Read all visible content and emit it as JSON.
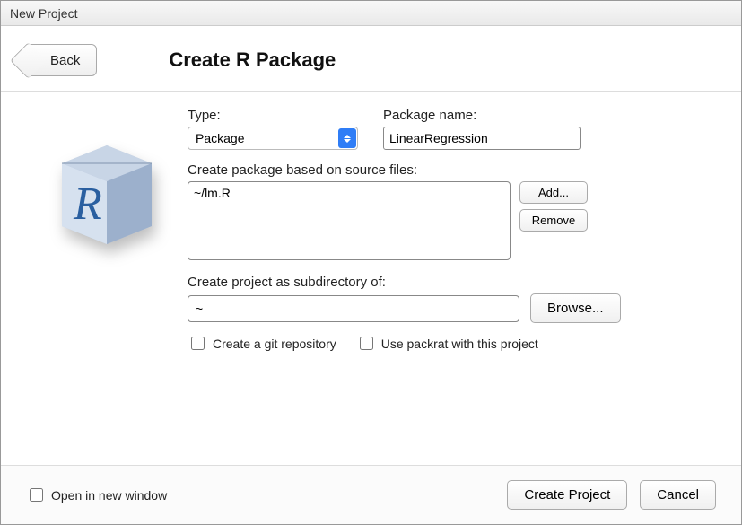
{
  "window": {
    "title": "New Project"
  },
  "header": {
    "back_label": "Back",
    "page_title": "Create R Package"
  },
  "form": {
    "type_label": "Type:",
    "type_value": "Package",
    "name_label": "Package name:",
    "name_value": "LinearRegression",
    "source_label": "Create package based on source files:",
    "source_value": "~/lm.R",
    "add_label": "Add...",
    "remove_label": "Remove",
    "subdir_label": "Create project as subdirectory of:",
    "subdir_value": "~",
    "browse_label": "Browse...",
    "git_label": "Create a git repository",
    "packrat_label": "Use packrat with this project"
  },
  "footer": {
    "open_new_window_label": "Open in new window",
    "create_label": "Create Project",
    "cancel_label": "Cancel"
  },
  "icons": {
    "package": "r-package-box-icon",
    "dropdown": "chevron-up-down-icon"
  }
}
